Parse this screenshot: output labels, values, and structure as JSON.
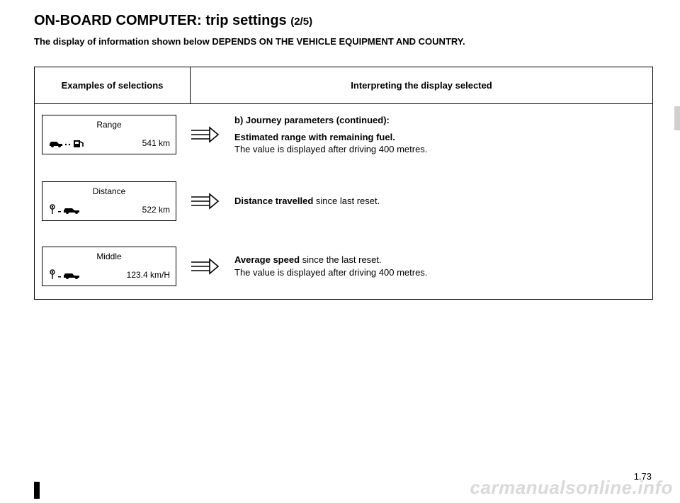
{
  "title_main": "ON-BOARD COMPUTER: trip settings ",
  "title_sub": "(2/5)",
  "note": "The display of information shown below DEPENDS ON THE VEHICLE EQUIPMENT AND COUNTRY.",
  "headers": {
    "col1": "Examples of selections",
    "col2": "Interpreting the display selected"
  },
  "rows": [
    {
      "panel": {
        "title": "Range",
        "value": "541 km",
        "type": "range"
      },
      "desc": {
        "heading": "b) Journey parameters (continued):",
        "lead": "Estimated range with remaining fuel.",
        "rest": "",
        "line2": "The value is displayed after driving 400 metres."
      }
    },
    {
      "panel": {
        "title": "Distance",
        "value": "522 km",
        "type": "distance"
      },
      "desc": {
        "heading": "",
        "lead": "Distance travelled ",
        "rest": "since last reset.",
        "line2": ""
      }
    },
    {
      "panel": {
        "title": "Middle",
        "value": "123.4 km/H",
        "type": "speed"
      },
      "desc": {
        "heading": "",
        "lead": "Average speed ",
        "rest": "since the last reset.",
        "line2": "The value is displayed after driving 400 metres."
      }
    }
  ],
  "page_number": "1.73",
  "watermark": "carmanualsonline.info"
}
